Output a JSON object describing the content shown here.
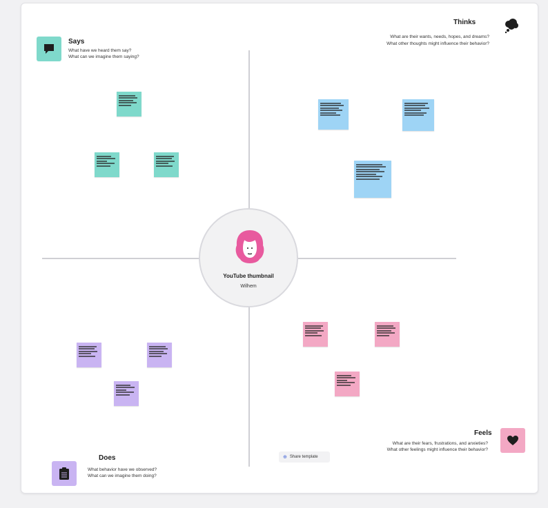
{
  "center": {
    "title": "YouTube thumbnail",
    "subtitle": "Wilhem"
  },
  "quadrants": {
    "says": {
      "title": "Says",
      "desc1": "What have we heard them say?",
      "desc2": "What can we imagine them saying?",
      "icon": "speech-bubble-icon",
      "color": "#7fd9cb"
    },
    "thinks": {
      "title": "Thinks",
      "desc1": "What are their wants, needs, hopes, and dreams?",
      "desc2": "What other thoughts might influence their behavior?",
      "icon": "thought-cloud-icon",
      "color": "#1e1e1e"
    },
    "does": {
      "title": "Does",
      "desc1": "What behavior have we observed?",
      "desc2": "What can we imagine them doing?",
      "icon": "clipboard-icon",
      "color": "#c9b4f2"
    },
    "feels": {
      "title": "Feels",
      "desc1": "What are their fears, frustrations, and anxieties?",
      "desc2": "What other feelings might influence their behavior?",
      "icon": "heart-icon",
      "color": "#f3a8c4"
    }
  },
  "link_button": {
    "label": "Share template"
  }
}
